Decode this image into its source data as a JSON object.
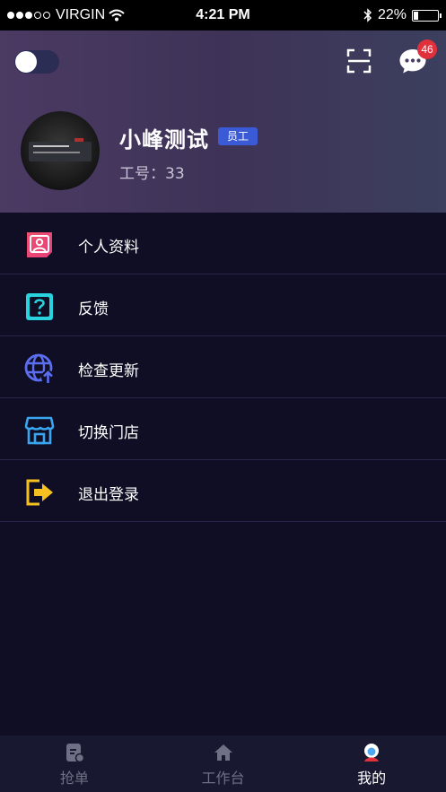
{
  "status_bar": {
    "carrier": "VIRGIN",
    "time": "4:21 PM",
    "battery": "22%",
    "battery_level": 0.22,
    "signal_bars": 3,
    "signal_total": 5
  },
  "header": {
    "toggle_on": false,
    "message_badge": "46",
    "username": "小峰测试",
    "role": "员工",
    "employee_id": "工号：33"
  },
  "menu": [
    {
      "label": "个人资料",
      "icon": "profile-icon"
    },
    {
      "label": "反馈",
      "icon": "feedback-icon"
    },
    {
      "label": "检查更新",
      "icon": "update-globe-icon"
    },
    {
      "label": "切换门店",
      "icon": "store-icon"
    },
    {
      "label": "退出登录",
      "icon": "logout-icon"
    }
  ],
  "tabs": [
    {
      "label": "抢单",
      "icon": "clipboard-icon",
      "active": false
    },
    {
      "label": "工作台",
      "icon": "home-icon",
      "active": false
    },
    {
      "label": "我的",
      "icon": "person-icon",
      "active": true
    }
  ],
  "colors": {
    "background": "#0f0e25",
    "role_badge": "#3b5bd6",
    "notification_badge": "#e0303c",
    "profile_icon": "#f0506e",
    "feedback_icon": "#29d3de",
    "update_icon": "#5b6ef0",
    "store_icon": "#3aa6f0",
    "logout_icon": "#f5c020"
  }
}
